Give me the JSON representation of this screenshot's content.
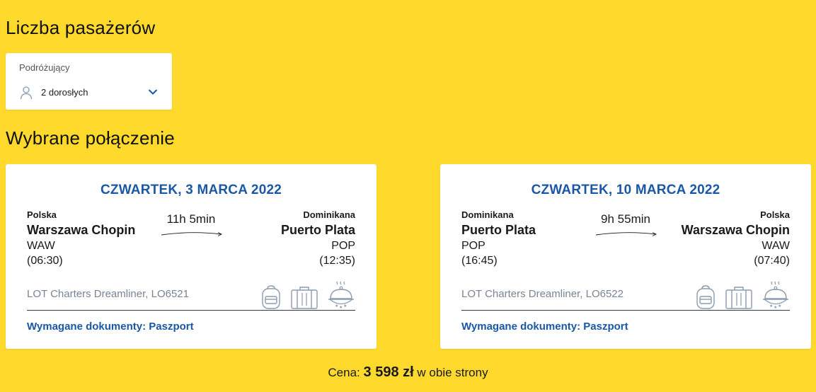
{
  "passengers": {
    "title": "Liczba pasażerów",
    "field_label": "Podróżujący",
    "value": "2 dorosłych"
  },
  "connection": {
    "title": "Wybrane połączenie"
  },
  "flights": [
    {
      "date": "CZWARTEK, 3 MARCA 2022",
      "origin": {
        "country": "Polska",
        "city": "Warszawa Chopin",
        "code": "WAW",
        "time": "(06:30)"
      },
      "destination": {
        "country": "Dominikana",
        "city": "Puerto Plata",
        "code": "POP",
        "time": "(12:35)"
      },
      "duration": "11h 5min",
      "operator": "LOT Charters Dreamliner, LO6521",
      "documents": "Wymagane dokumenty: Paszport"
    },
    {
      "date": "CZWARTEK, 10 MARCA 2022",
      "origin": {
        "country": "Dominikana",
        "city": "Puerto Plata",
        "code": "POP",
        "time": "(16:45)"
      },
      "destination": {
        "country": "Polska",
        "city": "Warszawa Chopin",
        "code": "WAW",
        "time": "(07:40)"
      },
      "duration": "9h 55min",
      "operator": "LOT Charters Dreamliner, LO6522",
      "documents": "Wymagane dokumenty: Paszport"
    }
  ],
  "amenity_icons": [
    "backpack-icon",
    "suitcase-icon",
    "meal-cloche-icon"
  ],
  "price": {
    "prefix": "Cena:",
    "amount": "3 598 zł",
    "suffix": "w obie strony"
  },
  "colors": {
    "background": "#ffd92c",
    "accent_blue": "#1a58a5",
    "icon_gray": "#8a9bb0"
  }
}
